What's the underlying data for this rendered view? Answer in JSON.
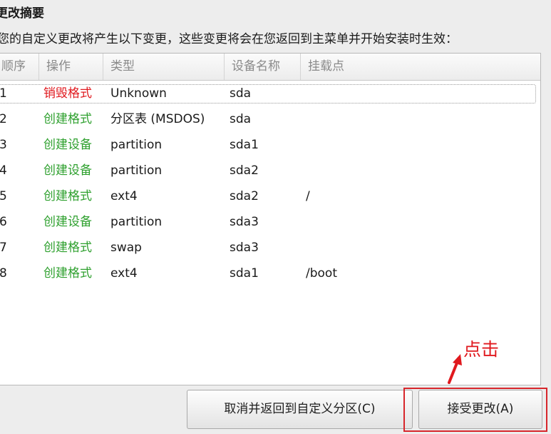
{
  "title": "更改摘要",
  "description": "您的自定义更改将产生以下变更，这些变更将会在您返回到主菜单并开始安装时生效：",
  "table": {
    "headers": [
      "顺序",
      "操作",
      "类型",
      "设备名称",
      "挂载点"
    ],
    "rows": [
      {
        "order": "1",
        "action": "销毁格式",
        "action_color": "red",
        "type": "Unknown",
        "device": "sda",
        "mount": ""
      },
      {
        "order": "2",
        "action": "创建格式",
        "action_color": "green",
        "type": "分区表 (MSDOS)",
        "device": "sda",
        "mount": ""
      },
      {
        "order": "3",
        "action": "创建设备",
        "action_color": "green",
        "type": "partition",
        "device": "sda1",
        "mount": ""
      },
      {
        "order": "4",
        "action": "创建设备",
        "action_color": "green",
        "type": "partition",
        "device": "sda2",
        "mount": ""
      },
      {
        "order": "5",
        "action": "创建格式",
        "action_color": "green",
        "type": "ext4",
        "device": "sda2",
        "mount": "/"
      },
      {
        "order": "6",
        "action": "创建设备",
        "action_color": "green",
        "type": "partition",
        "device": "sda3",
        "mount": ""
      },
      {
        "order": "7",
        "action": "创建格式",
        "action_color": "green",
        "type": "swap",
        "device": "sda3",
        "mount": ""
      },
      {
        "order": "8",
        "action": "创建格式",
        "action_color": "green",
        "type": "ext4",
        "device": "sda1",
        "mount": "/boot"
      }
    ]
  },
  "buttons": {
    "cancel_label": "取消并返回到自定义分区(C)",
    "accept_label": "接受更改(A)"
  },
  "annotation": {
    "text": "点击",
    "icon": "arrow-icon"
  },
  "colors": {
    "destroy": "#e0191e",
    "create": "#2ea02e",
    "annotation": "#d7262b"
  }
}
